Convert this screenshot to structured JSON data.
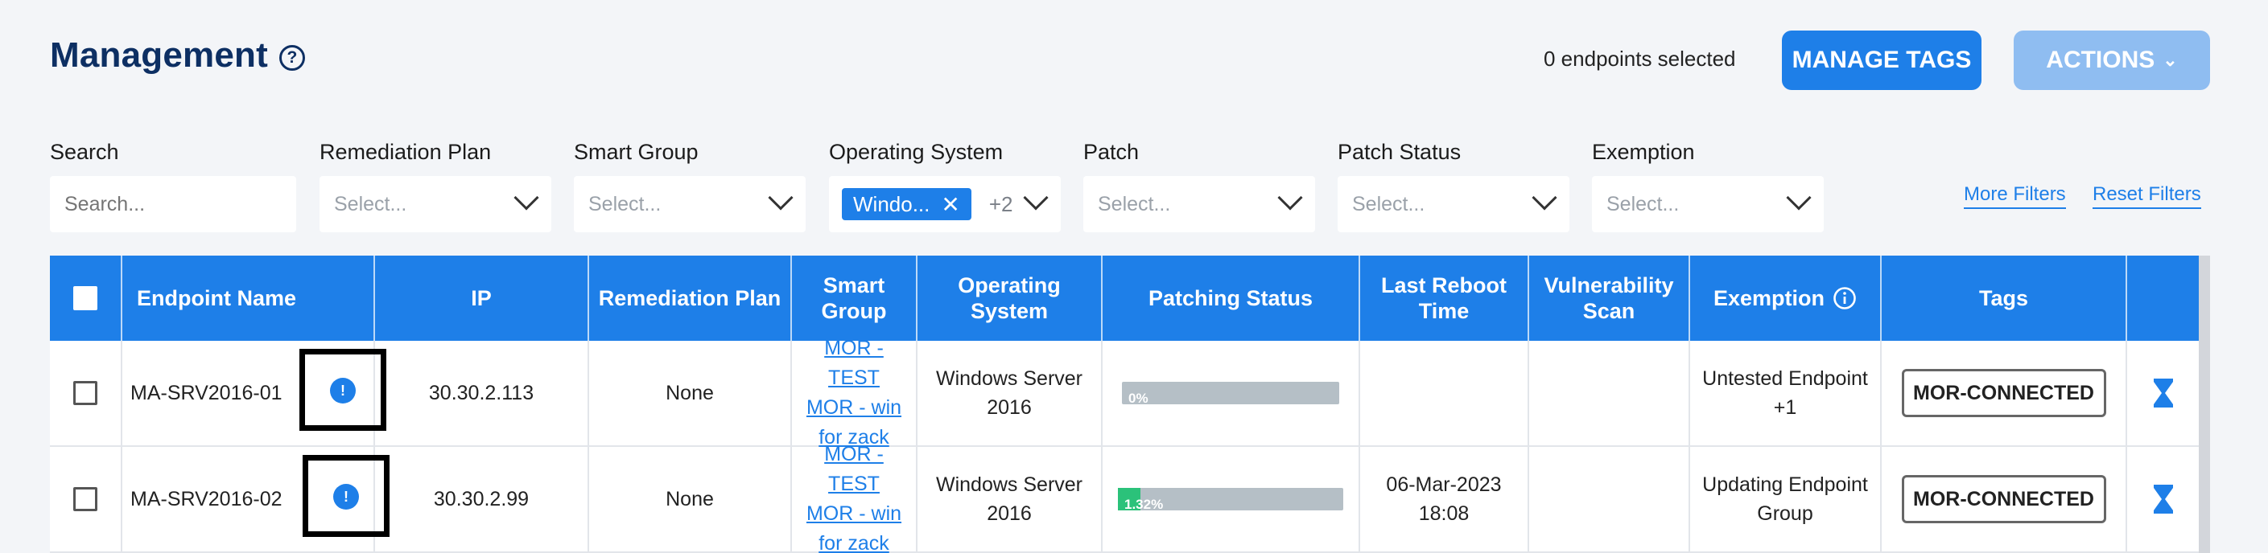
{
  "header": {
    "title": "Management",
    "help_glyph": "?",
    "selected_text": "0 endpoints selected",
    "manage_tags_label": "MANAGE TAGS",
    "actions_label": "ACTIONS"
  },
  "filters": {
    "search": {
      "label": "Search",
      "placeholder": "Search..."
    },
    "remediation_plan": {
      "label": "Remediation Plan",
      "placeholder": "Select..."
    },
    "smart_group": {
      "label": "Smart Group",
      "placeholder": "Select..."
    },
    "operating_system": {
      "label": "Operating System",
      "chip": "Windo...",
      "extra": "+2"
    },
    "patch": {
      "label": "Patch",
      "placeholder": "Select..."
    },
    "patch_status": {
      "label": "Patch Status",
      "placeholder": "Select..."
    },
    "exemption": {
      "label": "Exemption",
      "placeholder": "Select..."
    },
    "more_filters": "More Filters",
    "reset_filters": "Reset Filters"
  },
  "table": {
    "columns": {
      "endpoint_name": "Endpoint Name",
      "ip": "IP",
      "remediation_plan": "Remediation Plan",
      "smart_group": "Smart Group",
      "operating_system": "Operating System",
      "patching_status": "Patching Status",
      "last_reboot_time": "Last Reboot Time",
      "vulnerability_scan": "Vulnerability Scan",
      "exemption": "Exemption",
      "tags": "Tags"
    },
    "rows": [
      {
        "endpoint_name": "MA-SRV2016-01",
        "ip": "30.30.2.113",
        "remediation_plan": "None",
        "smart_group": [
          "MOR - TEST",
          "MOR - win",
          "for zack"
        ],
        "operating_system": [
          "Windows Server",
          "2016"
        ],
        "patching_percent": 0,
        "patching_label": "0%",
        "last_reboot": [
          "",
          ""
        ],
        "vulnerability_scan": "",
        "exemption": [
          "Untested Endpoint",
          "+1"
        ],
        "tag": "MOR-CONNECTED"
      },
      {
        "endpoint_name": "MA-SRV2016-02",
        "ip": "30.30.2.99",
        "remediation_plan": "None",
        "smart_group": [
          "MOR - TEST",
          "MOR - win",
          "for zack"
        ],
        "operating_system": [
          "Windows Server",
          "2016"
        ],
        "patching_percent": 1.32,
        "patching_label": "1.32%",
        "last_reboot": [
          "06-Mar-2023",
          "18:08"
        ],
        "vulnerability_scan": "",
        "exemption": [
          "Updating Endpoint",
          "Group"
        ],
        "tag": "MOR-CONNECTED"
      }
    ]
  },
  "colors": {
    "primary": "#1e7fe8",
    "title": "#0d2f63",
    "progress_fill": "#2bc27a",
    "progress_track": "#b5bfc6"
  },
  "icons": {
    "help": "help-circle-icon",
    "chevron": "chevron-down-icon",
    "remove": "close-icon",
    "info": "info-icon",
    "status": "hourglass-icon"
  }
}
